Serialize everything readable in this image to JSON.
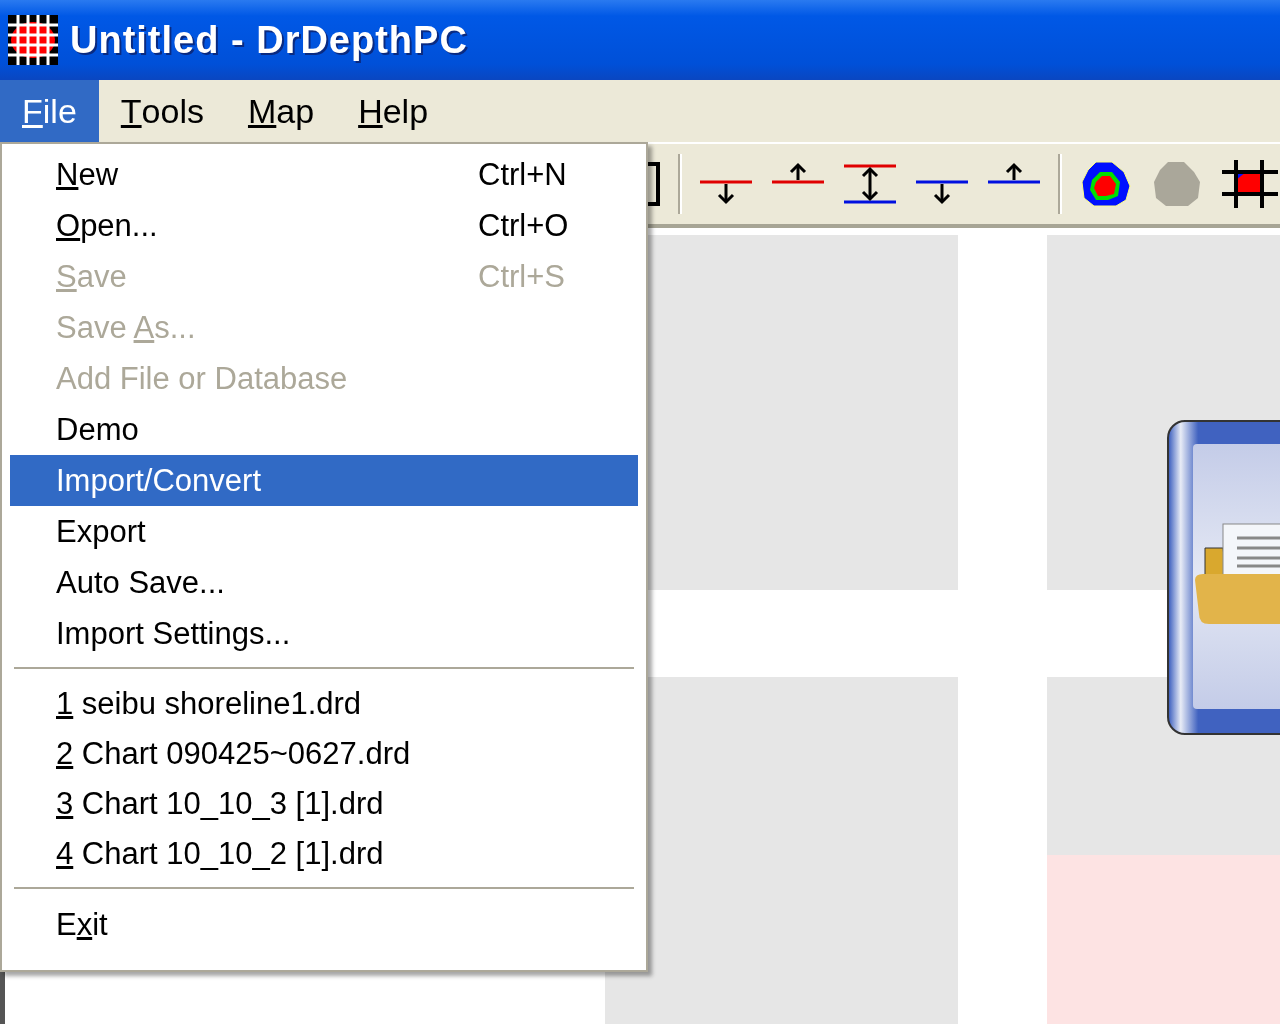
{
  "window": {
    "title": "Untitled - DrDepthPC"
  },
  "menu_bar": [
    {
      "access_key": "F",
      "label_after": "ile",
      "selected": true
    },
    {
      "access_key": "T",
      "label_after": "ools",
      "selected": false
    },
    {
      "access_key": "M",
      "label_after": "ap",
      "selected": false
    },
    {
      "access_key": "H",
      "label_after": "elp",
      "selected": false
    }
  ],
  "file_menu": {
    "items": [
      {
        "kind": "command",
        "access_key": "N",
        "label_after": "ew",
        "shortcut": "Ctrl+N",
        "disabled": false,
        "selected": false
      },
      {
        "kind": "command",
        "access_key": "O",
        "label_after": "pen...",
        "shortcut": "Ctrl+O",
        "disabled": false,
        "selected": false
      },
      {
        "kind": "command",
        "access_key": "S",
        "label_after": "ave",
        "shortcut": "Ctrl+S",
        "disabled": true,
        "selected": false
      },
      {
        "kind": "command",
        "label_before": "Save ",
        "access_key": "A",
        "label_after": "s...",
        "disabled": true,
        "selected": false
      },
      {
        "kind": "command",
        "label_before": "Add File or Database",
        "disabled": true,
        "selected": false
      },
      {
        "kind": "command",
        "label_before": "Demo",
        "disabled": false,
        "selected": false
      },
      {
        "kind": "command",
        "label_before": "Import/Convert",
        "disabled": false,
        "selected": true
      },
      {
        "kind": "command",
        "label_before": "Export",
        "disabled": false,
        "selected": false
      },
      {
        "kind": "command",
        "label_before": "Auto Save...",
        "disabled": false,
        "selected": false
      },
      {
        "kind": "command",
        "label_before": "Import Settings...",
        "disabled": false,
        "selected": false
      },
      {
        "kind": "separator"
      },
      {
        "kind": "recent",
        "access_key": "1",
        "label_after": " seibu shoreline1.drd",
        "disabled": false,
        "selected": false
      },
      {
        "kind": "recent",
        "access_key": "2",
        "label_after": " Chart 090425~0627.drd",
        "disabled": false,
        "selected": false
      },
      {
        "kind": "recent",
        "access_key": "3",
        "label_after": " Chart 10_10_3 [1].drd",
        "disabled": false,
        "selected": false
      },
      {
        "kind": "recent",
        "access_key": "4",
        "label_after": " Chart 10_10_2 [1].drd",
        "disabled": false,
        "selected": false
      },
      {
        "kind": "separator"
      },
      {
        "kind": "command",
        "label_before": "E",
        "access_key": "x",
        "label_after": "it",
        "disabled": false,
        "selected": false
      }
    ]
  },
  "toolbar": [
    {
      "kind": "edge"
    },
    {
      "kind": "separator"
    },
    {
      "kind": "red-down"
    },
    {
      "kind": "red-up"
    },
    {
      "kind": "red-blue"
    },
    {
      "kind": "blue-down"
    },
    {
      "kind": "blue-up"
    },
    {
      "kind": "separator"
    },
    {
      "kind": "contour"
    },
    {
      "kind": "blob"
    },
    {
      "kind": "grid"
    }
  ]
}
